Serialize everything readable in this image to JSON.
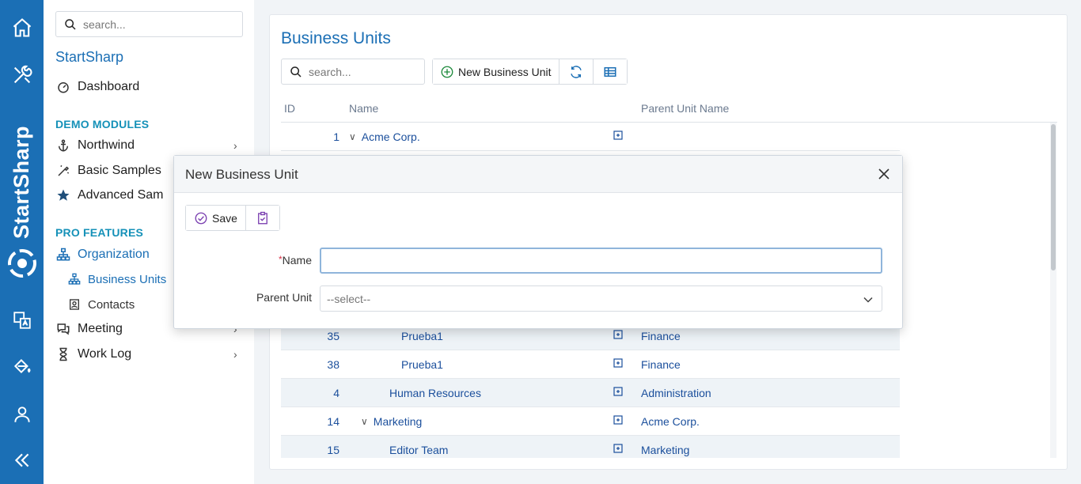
{
  "sidebar": {
    "brand": "StartSharp",
    "search_placeholder": "search...",
    "app_title": "StartSharp",
    "dashboard": "Dashboard",
    "demo_header": "DEMO MODULES",
    "northwind": "Northwind",
    "basic_samples": "Basic Samples",
    "advanced_samples": "Advanced Sam",
    "pro_header": "PRO FEATURES",
    "organization": "Organization",
    "business_units": "Business Units",
    "contacts": "Contacts",
    "meeting": "Meeting",
    "work_log": "Work Log"
  },
  "page": {
    "title": "Business Units",
    "search_placeholder": "search...",
    "new_button": "New Business Unit",
    "columns": {
      "id": "ID",
      "name": "Name",
      "parent": "Parent Unit Name"
    }
  },
  "rows": [
    {
      "id": "1",
      "name": "Acme Corp.",
      "parent": "",
      "expanded": true,
      "indent": 0
    },
    {
      "id": "35",
      "name": "Prueba1",
      "parent": "Finance",
      "indent": 3
    },
    {
      "id": "38",
      "name": "Prueba1",
      "parent": "Finance",
      "indent": 3
    },
    {
      "id": "4",
      "name": "Human Resources",
      "parent": "Administration",
      "indent": 2
    },
    {
      "id": "14",
      "name": "Marketing",
      "parent": "Acme Corp.",
      "expanded": true,
      "indent": 1
    },
    {
      "id": "15",
      "name": "Editor Team",
      "parent": "Marketing",
      "indent": 2
    }
  ],
  "dialog": {
    "title": "New Business Unit",
    "save": "Save",
    "name_label": "Name",
    "required_mark": "*",
    "name_value": "",
    "parent_label": "Parent Unit",
    "parent_placeholder": "--select--"
  },
  "colors": {
    "accent": "#1b6fb5",
    "rail": "#1b6fb5",
    "section": "#1591b8"
  }
}
